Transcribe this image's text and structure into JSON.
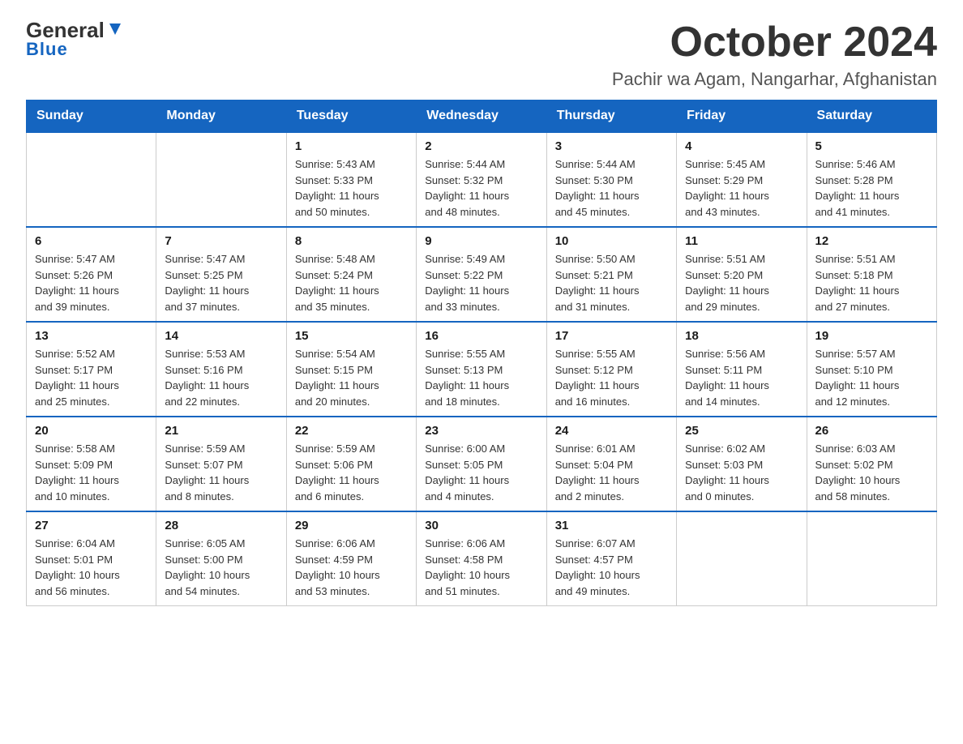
{
  "header": {
    "logo_general": "General",
    "logo_blue": "Blue",
    "month": "October 2024",
    "location": "Pachir wa Agam, Nangarhar, Afghanistan"
  },
  "days_of_week": [
    "Sunday",
    "Monday",
    "Tuesday",
    "Wednesday",
    "Thursday",
    "Friday",
    "Saturday"
  ],
  "weeks": [
    [
      {
        "day": "",
        "info": ""
      },
      {
        "day": "",
        "info": ""
      },
      {
        "day": "1",
        "info": "Sunrise: 5:43 AM\nSunset: 5:33 PM\nDaylight: 11 hours\nand 50 minutes."
      },
      {
        "day": "2",
        "info": "Sunrise: 5:44 AM\nSunset: 5:32 PM\nDaylight: 11 hours\nand 48 minutes."
      },
      {
        "day": "3",
        "info": "Sunrise: 5:44 AM\nSunset: 5:30 PM\nDaylight: 11 hours\nand 45 minutes."
      },
      {
        "day": "4",
        "info": "Sunrise: 5:45 AM\nSunset: 5:29 PM\nDaylight: 11 hours\nand 43 minutes."
      },
      {
        "day": "5",
        "info": "Sunrise: 5:46 AM\nSunset: 5:28 PM\nDaylight: 11 hours\nand 41 minutes."
      }
    ],
    [
      {
        "day": "6",
        "info": "Sunrise: 5:47 AM\nSunset: 5:26 PM\nDaylight: 11 hours\nand 39 minutes."
      },
      {
        "day": "7",
        "info": "Sunrise: 5:47 AM\nSunset: 5:25 PM\nDaylight: 11 hours\nand 37 minutes."
      },
      {
        "day": "8",
        "info": "Sunrise: 5:48 AM\nSunset: 5:24 PM\nDaylight: 11 hours\nand 35 minutes."
      },
      {
        "day": "9",
        "info": "Sunrise: 5:49 AM\nSunset: 5:22 PM\nDaylight: 11 hours\nand 33 minutes."
      },
      {
        "day": "10",
        "info": "Sunrise: 5:50 AM\nSunset: 5:21 PM\nDaylight: 11 hours\nand 31 minutes."
      },
      {
        "day": "11",
        "info": "Sunrise: 5:51 AM\nSunset: 5:20 PM\nDaylight: 11 hours\nand 29 minutes."
      },
      {
        "day": "12",
        "info": "Sunrise: 5:51 AM\nSunset: 5:18 PM\nDaylight: 11 hours\nand 27 minutes."
      }
    ],
    [
      {
        "day": "13",
        "info": "Sunrise: 5:52 AM\nSunset: 5:17 PM\nDaylight: 11 hours\nand 25 minutes."
      },
      {
        "day": "14",
        "info": "Sunrise: 5:53 AM\nSunset: 5:16 PM\nDaylight: 11 hours\nand 22 minutes."
      },
      {
        "day": "15",
        "info": "Sunrise: 5:54 AM\nSunset: 5:15 PM\nDaylight: 11 hours\nand 20 minutes."
      },
      {
        "day": "16",
        "info": "Sunrise: 5:55 AM\nSunset: 5:13 PM\nDaylight: 11 hours\nand 18 minutes."
      },
      {
        "day": "17",
        "info": "Sunrise: 5:55 AM\nSunset: 5:12 PM\nDaylight: 11 hours\nand 16 minutes."
      },
      {
        "day": "18",
        "info": "Sunrise: 5:56 AM\nSunset: 5:11 PM\nDaylight: 11 hours\nand 14 minutes."
      },
      {
        "day": "19",
        "info": "Sunrise: 5:57 AM\nSunset: 5:10 PM\nDaylight: 11 hours\nand 12 minutes."
      }
    ],
    [
      {
        "day": "20",
        "info": "Sunrise: 5:58 AM\nSunset: 5:09 PM\nDaylight: 11 hours\nand 10 minutes."
      },
      {
        "day": "21",
        "info": "Sunrise: 5:59 AM\nSunset: 5:07 PM\nDaylight: 11 hours\nand 8 minutes."
      },
      {
        "day": "22",
        "info": "Sunrise: 5:59 AM\nSunset: 5:06 PM\nDaylight: 11 hours\nand 6 minutes."
      },
      {
        "day": "23",
        "info": "Sunrise: 6:00 AM\nSunset: 5:05 PM\nDaylight: 11 hours\nand 4 minutes."
      },
      {
        "day": "24",
        "info": "Sunrise: 6:01 AM\nSunset: 5:04 PM\nDaylight: 11 hours\nand 2 minutes."
      },
      {
        "day": "25",
        "info": "Sunrise: 6:02 AM\nSunset: 5:03 PM\nDaylight: 11 hours\nand 0 minutes."
      },
      {
        "day": "26",
        "info": "Sunrise: 6:03 AM\nSunset: 5:02 PM\nDaylight: 10 hours\nand 58 minutes."
      }
    ],
    [
      {
        "day": "27",
        "info": "Sunrise: 6:04 AM\nSunset: 5:01 PM\nDaylight: 10 hours\nand 56 minutes."
      },
      {
        "day": "28",
        "info": "Sunrise: 6:05 AM\nSunset: 5:00 PM\nDaylight: 10 hours\nand 54 minutes."
      },
      {
        "day": "29",
        "info": "Sunrise: 6:06 AM\nSunset: 4:59 PM\nDaylight: 10 hours\nand 53 minutes."
      },
      {
        "day": "30",
        "info": "Sunrise: 6:06 AM\nSunset: 4:58 PM\nDaylight: 10 hours\nand 51 minutes."
      },
      {
        "day": "31",
        "info": "Sunrise: 6:07 AM\nSunset: 4:57 PM\nDaylight: 10 hours\nand 49 minutes."
      },
      {
        "day": "",
        "info": ""
      },
      {
        "day": "",
        "info": ""
      }
    ]
  ]
}
